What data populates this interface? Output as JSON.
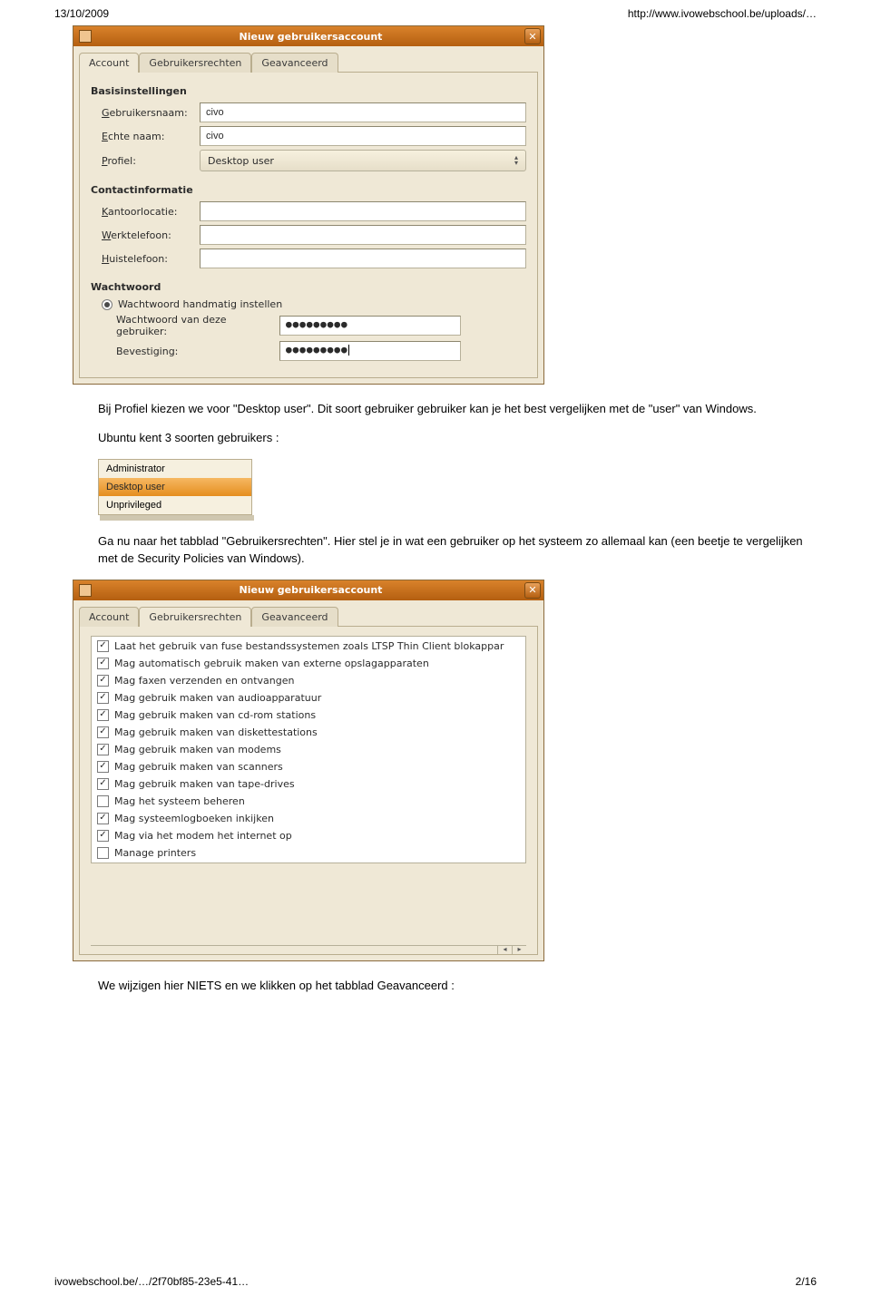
{
  "header": {
    "date": "13/10/2009",
    "url": "http://www.ivowebschool.be/uploads/…"
  },
  "footer": {
    "left": "ivowebschool.be/…/2f70bf85-23e5-41…",
    "right": "2/16"
  },
  "win1": {
    "title": "Nieuw gebruikersaccount",
    "tabs": {
      "t0": "Account",
      "t1": "Gebruikersrechten",
      "t2": "Geavanceerd"
    },
    "basis_hdr": "Basisinstellingen",
    "rows": {
      "gebruikersnaam_lbl_pre": "",
      "gebruikersnaam_lbl_u": "G",
      "gebruikersnaam_lbl_post": "ebruikersnaam:",
      "gebruikersnaam_val": "civo",
      "echtenaam_lbl_pre": "",
      "echtenaam_lbl_u": "E",
      "echtenaam_lbl_post": "chte naam:",
      "echtenaam_val": "civo",
      "profiel_lbl_pre": "",
      "profiel_lbl_u": "P",
      "profiel_lbl_post": "rofiel:",
      "profiel_val": "Desktop user"
    },
    "contact_hdr": "Contactinformatie",
    "contact": {
      "kantoor_u": "K",
      "kantoor_post": "antoorlocatie:",
      "werktel_u": "W",
      "werktel_post": "erktelefoon:",
      "huistel_u": "H",
      "huistel_post": "uistelefoon:"
    },
    "pw_hdr": "Wachtwoord",
    "pw_radio": "Wachtwoord handmatig instellen",
    "pw_user_u": "W",
    "pw_user_post": "achtwoord van deze gebruiker:",
    "pw_user_val": "●●●●●●●●●",
    "pw_conf_u": "B",
    "pw_conf_post": "evestiging:",
    "pw_conf_val": "●●●●●●●●●"
  },
  "para1a": "Bij Profiel kiezen we voor \"Desktop user\". Dit soort gebruiker gebruiker kan je het best vergelijken met de \"user\" van Windows.",
  "para1b": "Ubuntu kent 3 soorten gebruikers :",
  "popup": {
    "o0": "Administrator",
    "o1": "Desktop user",
    "o2": "Unprivileged"
  },
  "para2": "Ga nu naar het tabblad \"Gebruikersrechten\". Hier stel je in wat een gebruiker op het systeem zo allemaal kan (een beetje te vergelijken met de Security Policies van Windows).",
  "win2": {
    "title": "Nieuw gebruikersaccount",
    "tabs": {
      "t0": "Account",
      "t1": "Gebruikersrechten",
      "t2": "Geavanceerd"
    },
    "items": [
      {
        "c": true,
        "t": "Laat het gebruik van fuse bestandssystemen zoals LTSP Thin Client blokappar"
      },
      {
        "c": true,
        "t": "Mag automatisch gebruik maken van externe opslagapparaten"
      },
      {
        "c": true,
        "t": "Mag faxen verzenden en ontvangen"
      },
      {
        "c": true,
        "t": "Mag gebruik maken van audioapparatuur"
      },
      {
        "c": true,
        "t": "Mag gebruik maken van cd-rom stations"
      },
      {
        "c": true,
        "t": "Mag gebruik maken van diskettestations"
      },
      {
        "c": true,
        "t": "Mag gebruik maken van modems"
      },
      {
        "c": true,
        "t": "Mag gebruik maken van scanners"
      },
      {
        "c": true,
        "t": "Mag gebruik maken van tape-drives"
      },
      {
        "c": false,
        "t": "Mag het systeem beheren"
      },
      {
        "c": true,
        "t": "Mag systeemlogboeken inkijken"
      },
      {
        "c": true,
        "t": "Mag via het modem het internet op"
      },
      {
        "c": false,
        "t": "Manage printers"
      }
    ]
  },
  "para3": "We wijzigen hier NIETS en we klikken op het tabblad Geavanceerd :"
}
